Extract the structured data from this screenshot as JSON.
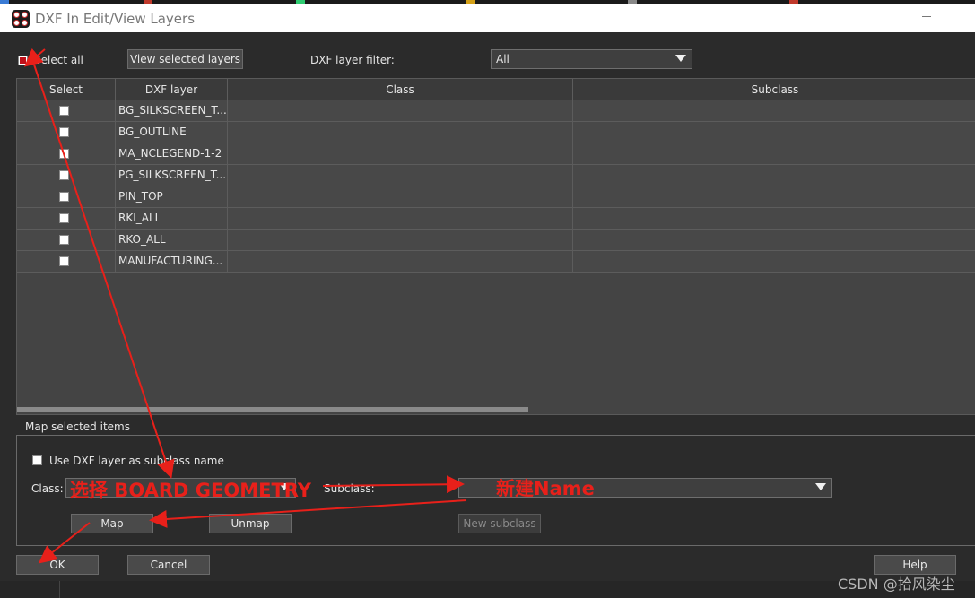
{
  "window": {
    "title": "DXF In Edit/View Layers"
  },
  "toolbar": {
    "select_all_label": "Select all",
    "select_all_checked": true,
    "view_selected_label": "View selected layers",
    "filter_label": "DXF layer filter:",
    "filter_value": "All"
  },
  "table": {
    "columns": [
      "Select",
      "DXF layer",
      "Class",
      "Subclass"
    ],
    "rows": [
      {
        "layer": "BG_SILKSCREEN_T...",
        "class": "",
        "subclass": ""
      },
      {
        "layer": "BG_OUTLINE",
        "class": "",
        "subclass": ""
      },
      {
        "layer": "MA_NCLEGEND-1-2",
        "class": "",
        "subclass": ""
      },
      {
        "layer": "PG_SILKSCREEN_T...",
        "class": "",
        "subclass": ""
      },
      {
        "layer": "PIN_TOP",
        "class": "",
        "subclass": ""
      },
      {
        "layer": "RKI_ALL",
        "class": "",
        "subclass": ""
      },
      {
        "layer": "RKO_ALL",
        "class": "",
        "subclass": ""
      },
      {
        "layer": "MANUFACTURING...",
        "class": "",
        "subclass": ""
      }
    ]
  },
  "map_group": {
    "title": "Map selected items",
    "use_dxf_label": "Use DXF layer as subclass name",
    "class_label": "Class:",
    "subclass_label": "Subclass:",
    "map_label": "Map",
    "unmap_label": "Unmap",
    "new_subclass_label": "New subclass"
  },
  "footer": {
    "ok_label": "OK",
    "cancel_label": "Cancel",
    "help_label": "Help"
  },
  "annotations": {
    "class_note": "选择 BOARD GEOMETRY",
    "subclass_note": "新建Name",
    "color": "#e8201a"
  },
  "watermark": "CSDN @拾风染尘",
  "colors": {
    "dialog_bg": "#2b2b2b",
    "grid_bg": "#444444",
    "title_bg": "#ffffff"
  }
}
